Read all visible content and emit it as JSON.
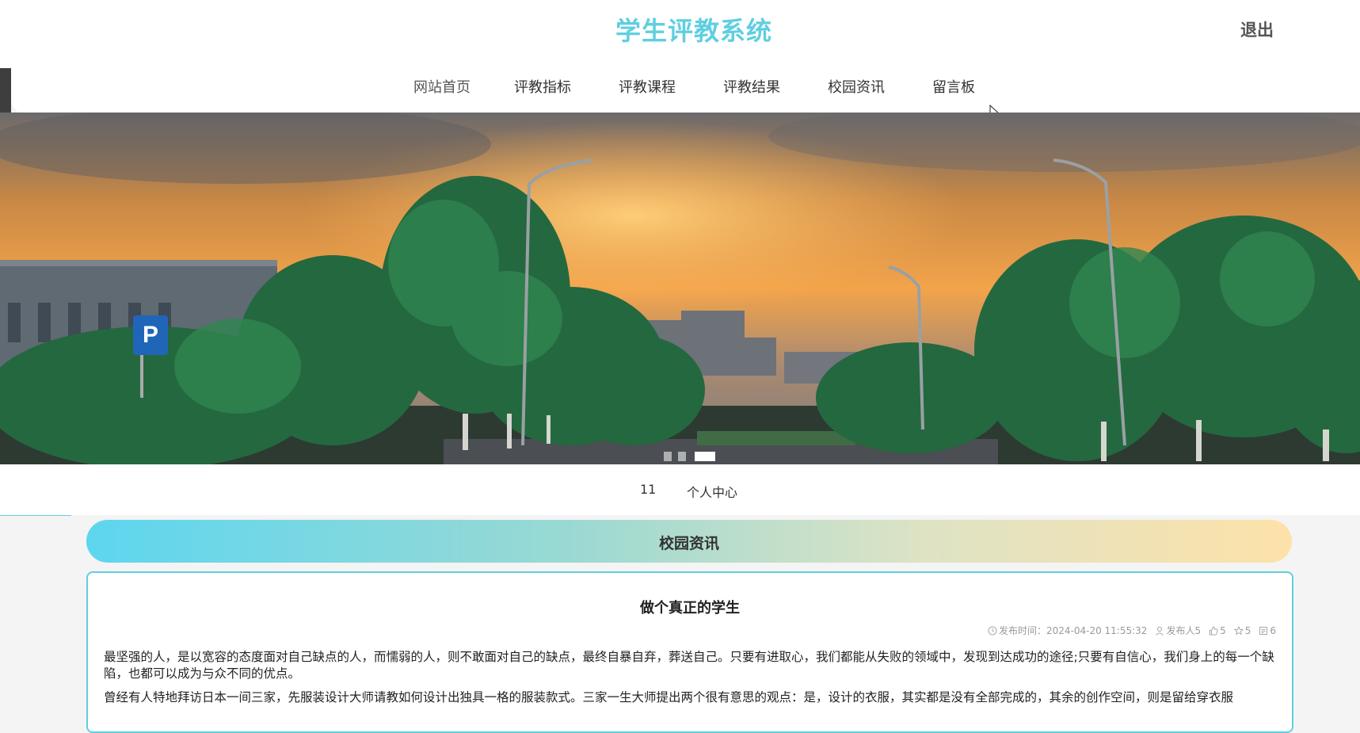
{
  "header": {
    "site_title": "学生评教系统",
    "logout_label": "退出"
  },
  "nav": {
    "items": [
      {
        "label": "网站首页"
      },
      {
        "label": "评教指标"
      },
      {
        "label": "评教课程"
      },
      {
        "label": "评教结果"
      },
      {
        "label": "校园资讯"
      },
      {
        "label": "留言板"
      }
    ]
  },
  "banner": {
    "slide_count": 3,
    "active_slide": 3
  },
  "subnav": {
    "username": "11",
    "personal_center": "个人中心"
  },
  "section": {
    "title": "校园资讯"
  },
  "article": {
    "title": "做个真正的学生",
    "meta": {
      "publish_time": "发布时间：2024-04-20 11:55:32",
      "publisher": "发布人5",
      "likes": "5",
      "favorites": "5",
      "comments": "6"
    },
    "paragraphs": [
      "最坚强的人，是以宽容的态度面对自己缺点的人，而懦弱的人，则不敢面对自己的缺点，最终自暴自弃，葬送自己。只要有进取心，我们都能从失败的领域中，发现到达成功的途径;只要有自信心，我们身上的每一个缺陷，也都可以成为与众不同的优点。",
      "曾经有人特地拜访日本一间三家，先服装设计大师请教如何设计出独具一格的服装款式。三家一生大师提出两个很有意思的观点：是，设计的衣服，其实都是没有全部完成的，其余的创作空间，则是留给穿衣服"
    ]
  },
  "colors": {
    "accent": "#5fcfe0",
    "gradient_start": "#5dd6ef",
    "gradient_end": "#fde2a9"
  }
}
